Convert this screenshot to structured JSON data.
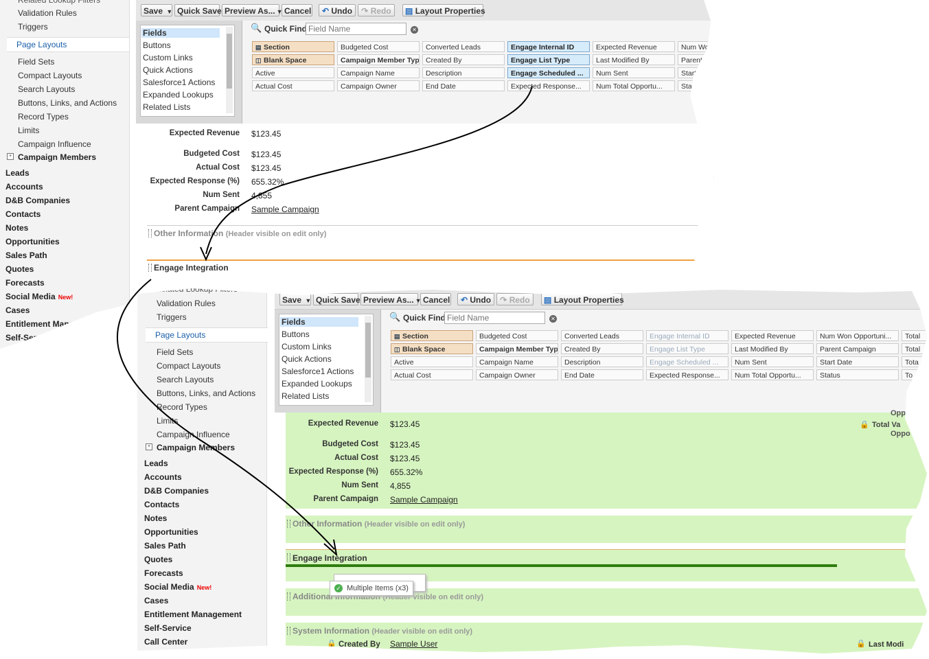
{
  "sidebar": {
    "top_cut": "Related Lookup Filters",
    "setup_items": [
      "Validation Rules",
      "Triggers"
    ],
    "selected": "Page Layouts",
    "sub_items": [
      "Field Sets",
      "Compact Layouts",
      "Search Layouts",
      "Buttons, Links, and Actions",
      "Record Types",
      "Limits",
      "Campaign Influence"
    ],
    "campaign_members": "Campaign Members",
    "objects": [
      "Leads",
      "Accounts",
      "D&B Companies",
      "Contacts",
      "Notes",
      "Opportunities",
      "Sales Path",
      "Quotes",
      "Forecasts",
      "Social Media",
      "Cases",
      "Entitlement Management",
      "Self-Service"
    ],
    "new_badge": "New!",
    "bottom_cut": "Call Center"
  },
  "toolbar": {
    "save": "Save",
    "quick_save": "Quick Save",
    "preview_as": "Preview As...",
    "cancel": "Cancel",
    "undo": "Undo",
    "redo": "Redo",
    "layout_properties": "Layout Properties"
  },
  "palette": {
    "categories": [
      "Fields",
      "Buttons",
      "Custom Links",
      "Quick Actions",
      "Salesforce1 Actions",
      "Expanded Lookups",
      "Related Lists"
    ],
    "quick_find_label": "Quick Find",
    "quick_find_placeholder": "Field Name",
    "grid1": [
      [
        "Section",
        "Budgeted Cost",
        "Converted Leads",
        "Engage Internal ID",
        "Expected Revenue",
        "Num Won"
      ],
      [
        "Blank Space",
        "Campaign Member Type",
        "Created By",
        "Engage List Type",
        "Last Modified By",
        "Parent C"
      ],
      [
        "Active",
        "Campaign Name",
        "Description",
        "Engage Scheduled ...",
        "Num Sent",
        "Start Da"
      ],
      [
        "Actual Cost",
        "Campaign Owner",
        "End Date",
        "Expected Response...",
        "Num Total Opportu...",
        "Status"
      ]
    ],
    "grid2": [
      [
        "Section",
        "Budgeted Cost",
        "Converted Leads",
        "Engage Internal ID",
        "Expected Revenue",
        "Num Won Opportuni...",
        "Total"
      ],
      [
        "Blank Space",
        "Campaign Member Type",
        "Created By",
        "Engage List Type",
        "Last Modified By",
        "Parent Campaign",
        "Total"
      ],
      [
        "Active",
        "Campaign Name",
        "Description",
        "Engage Scheduled ...",
        "Num Sent",
        "Start Date",
        "Tota"
      ],
      [
        "Actual Cost",
        "Campaign Owner",
        "End Date",
        "Expected Response...",
        "Num Total Opportu...",
        "Status",
        "To"
      ]
    ]
  },
  "details": {
    "labels": [
      "Expected Revenue",
      "Budgeted Cost",
      "Actual Cost",
      "Expected Response (%)",
      "Num Sent",
      "Parent Campaign"
    ],
    "values": [
      "$123.45",
      "$123.45",
      "$123.45",
      "655.32%",
      "4,855",
      "Sample Campaign"
    ]
  },
  "sections": {
    "other": "Other Information",
    "other_sub": "(Header visible on edit only)",
    "engage": "Engage Integration",
    "additional": "Additional Information",
    "additional_sub": "(Header visible on edit only)",
    "system": "System Information",
    "system_sub": "(Header visible on edit only)"
  },
  "panel2_extra": {
    "right_top": "Oppo",
    "total_val": "Total Va",
    "oppo2": "Oppo",
    "created_by": "Created By",
    "sample_user": "Sample User",
    "last_mod": "Last Modi",
    "tooltip": "Multiple Items (x3)"
  },
  "colors": {
    "drop_green": "#d6f4c0",
    "drop_line": "#2e7d0e",
    "selected_blue": "#1a5fa8",
    "section_tan": "#f5dfc4",
    "used_field_blue": "#d7ecfb"
  }
}
